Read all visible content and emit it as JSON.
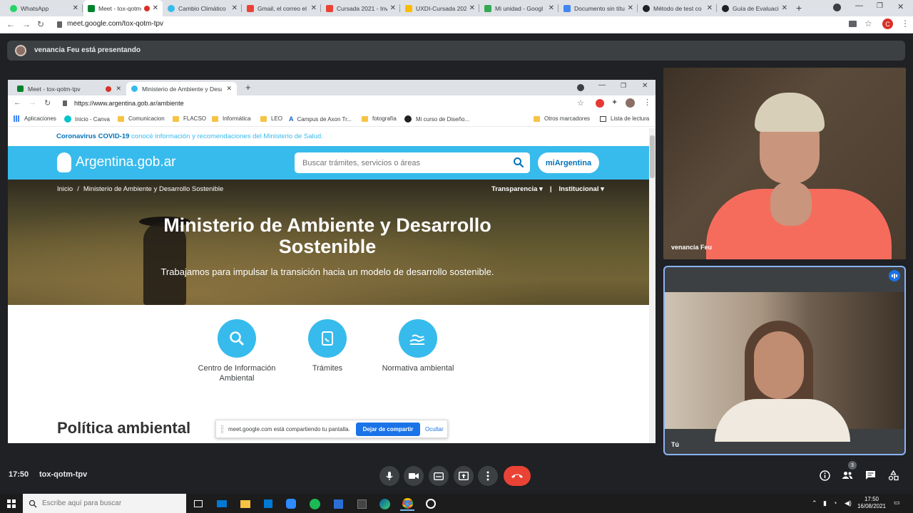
{
  "outer_browser": {
    "tabs": [
      {
        "title": "WhatsApp",
        "color": "#25d366"
      },
      {
        "title": "Meet - tox-qotm-tpv",
        "color": "#00832d"
      },
      {
        "title": "Cambio Climático",
        "color": "#37bbed"
      },
      {
        "title": "Gmail, el correo el",
        "color": "#ea4335"
      },
      {
        "title": "Cursada 2021 - Inv",
        "color": "#ea4335"
      },
      {
        "title": "UXDI-Cursada 202",
        "color": "#fbbc04"
      },
      {
        "title": "Mi unidad - Googl",
        "color": "#34a853"
      },
      {
        "title": "Documento sin títu",
        "color": "#4285f4"
      },
      {
        "title": "Método de test co",
        "color": "#202124"
      },
      {
        "title": "Guía de Evaluació",
        "color": "#202124"
      }
    ],
    "url": "meet.google.com/tox-qotm-tpv",
    "profile_initial": "C"
  },
  "presenting": {
    "text": "venancia Feu está presentando"
  },
  "shared_browser": {
    "tabs": [
      {
        "title": "Meet - tox-qotm-tpv"
      },
      {
        "title": "Ministerio de Ambiente y Desarr"
      }
    ],
    "url": "https://www.argentina.gob.ar/ambiente",
    "bookmarks": [
      "Aplicaciones",
      "Inicio - Canva",
      "Comunicacion",
      "FLACSO",
      "Informática",
      "LEO",
      "Campus de Axon Tr...",
      "fotografía",
      "Mi curso de Diseño...",
      "Otros marcadores",
      "Lista de lectura"
    ]
  },
  "page": {
    "covid_bold": "Coronavirus COVID-19",
    "covid_rest": " conocé información y recomendaciones del Ministerio de Salud.",
    "logo": "Argentina.gob.ar",
    "search_placeholder": "Buscar trámites, servicios o áreas",
    "mi_button": "miArgentina",
    "breadcrumb_home": "Inicio",
    "breadcrumb_sep": "/",
    "breadcrumb_current": "Ministerio de Ambiente y Desarrollo Sostenible",
    "menu_transparencia": "Transparencia ▾",
    "menu_sep": "|",
    "menu_institucional": "Institucional ▾",
    "hero_title": "Ministerio de Ambiente y Desarrollo Sostenible",
    "hero_subtitle": "Trabajamos para impulsar la transición hacia un modelo de desarrollo sostenible.",
    "services": [
      {
        "label": "Centro de Información Ambiental",
        "icon": "search-icon"
      },
      {
        "label": "Trámites",
        "icon": "phone-doc-icon"
      },
      {
        "label": "Normativa ambiental",
        "icon": "hand-water-icon"
      }
    ],
    "section_title": "Política ambiental"
  },
  "share_notice": {
    "text": "meet.google.com está compartiendo tu pantalla.",
    "stop": "Dejar de compartir",
    "hide": "Ocultar"
  },
  "participants": [
    {
      "name": "venancia Feu"
    },
    {
      "name": "Tú"
    }
  ],
  "meeting": {
    "time": "17:50",
    "code": "tox-qotm-tpv",
    "participants_count": "3"
  },
  "taskbar": {
    "search_placeholder": "Escribe aquí para buscar",
    "clock_time": "17:50",
    "clock_date": "16/08/2021"
  },
  "colors": {
    "accent": "#37bbed",
    "meet_bg": "#202124",
    "end_call": "#ea4335"
  }
}
